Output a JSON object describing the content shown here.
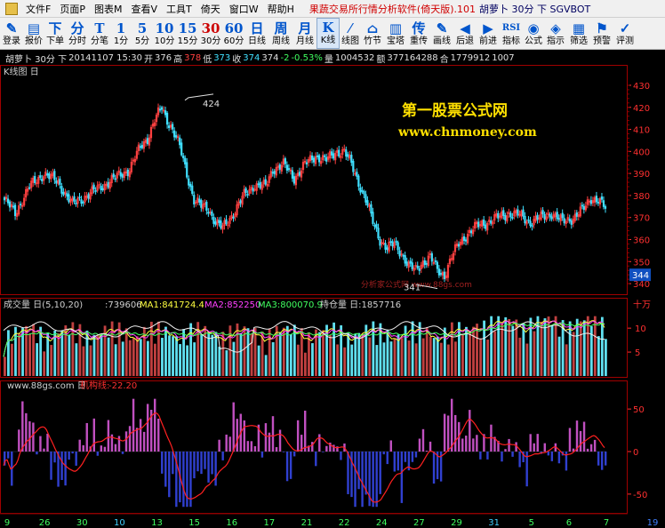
{
  "menubar": {
    "items": [
      "文件F",
      "页面P",
      "图表M",
      "查看V",
      "工具T",
      "倚天",
      "窗口W",
      "帮助H"
    ],
    "window_title": "果蔬交易所行情分析软件(倚天版).101",
    "window_symbol": "胡萝卜 30分 下 SGVBOT"
  },
  "toolbar": {
    "buttons": [
      {
        "icon": "✎",
        "label": "登录"
      },
      {
        "icon": "▤",
        "label": "报价"
      },
      {
        "icon": "下",
        "label": "下单"
      },
      {
        "icon": "分",
        "label": "分时"
      },
      {
        "icon": "T",
        "label": "分笔"
      },
      {
        "icon": "1",
        "label": "1分"
      },
      {
        "icon": "5",
        "label": "5分"
      },
      {
        "icon": "10",
        "label": "10分"
      },
      {
        "icon": "15",
        "label": "15分"
      },
      {
        "icon": "30",
        "label": "30分"
      },
      {
        "icon": "60",
        "label": "60分"
      },
      {
        "icon": "日",
        "label": "日线"
      },
      {
        "icon": "周",
        "label": "周线"
      },
      {
        "icon": "月",
        "label": "月线"
      },
      {
        "icon": "K",
        "label": "K线"
      },
      {
        "icon": "⁄",
        "label": "线图"
      },
      {
        "icon": "⌂",
        "label": "竹节"
      },
      {
        "icon": "▥",
        "label": "宝塔"
      },
      {
        "icon": "传",
        "label": "重传"
      },
      {
        "icon": "✎",
        "label": "画线"
      },
      {
        "icon": "◀",
        "label": "后退"
      },
      {
        "icon": "▶",
        "label": "前进"
      },
      {
        "icon": "RSI",
        "label": "指标"
      },
      {
        "icon": "◉",
        "label": "公式"
      },
      {
        "icon": "◈",
        "label": "指示"
      },
      {
        "icon": "▦",
        "label": "筛选"
      },
      {
        "icon": "⚑",
        "label": "预警"
      },
      {
        "icon": "✓",
        "label": "评测"
      }
    ]
  },
  "infobar": {
    "symbol": "胡萝卜 30分 下",
    "datetime": "20141107 15:30",
    "open_label": "开",
    "open": "376",
    "high_label": "高",
    "high": "378",
    "low_label": "低",
    "low": "373",
    "close_label": "收",
    "close": "374",
    "prev_close": "374",
    "change": "-2",
    "change_pct": "-0.53%",
    "volume_label": "量",
    "volume": "1004532",
    "amount_label": "额",
    "amount": "377164288",
    "oi_label": "合",
    "oi": "1779912",
    "extra": "1007"
  },
  "panels": {
    "kline": {
      "title": "K线图 日",
      "high_annotation": "424",
      "low_annotation": "341",
      "price_marker": "344",
      "watermark_title": "第一股票公式网",
      "watermark_url": "www.chnmoney.com",
      "faint_watermark": "分析家公式网 www.88gs.com"
    },
    "volume": {
      "title": "成交量 日(5,10,20)",
      "value": ":739606",
      "ma1": "MA1:841724.4",
      "ma2": "MA2:852250",
      "ma3": "MA3:800070.9",
      "oi_title": "持仓量 日:1857716",
      "unit": "十万"
    },
    "indicator": {
      "source": "www.88gs.com 日",
      "name": "机构线:",
      "value": "-22.20"
    }
  },
  "axes": {
    "price_ticks": [
      "430",
      "420",
      "410",
      "400",
      "390",
      "380",
      "370",
      "360",
      "350",
      "340"
    ],
    "volume_ticks": [
      "10",
      "5"
    ],
    "indicator_ticks": [
      "50",
      "0",
      "-50"
    ],
    "date_ticks": [
      "9",
      "26",
      "30",
      "10",
      "13",
      "15",
      "16",
      "17",
      "21",
      "22",
      "24",
      "27",
      "29",
      "31",
      "5",
      "6",
      "7",
      "19"
    ]
  },
  "chart_data": {
    "type": "candlestick",
    "price_range": [
      336,
      432
    ],
    "high_point": 424,
    "low_point": 341,
    "last_price": 344,
    "volume_range": [
      0,
      13
    ],
    "indicator_range": [
      -70,
      70
    ]
  },
  "colors": {
    "up": "#ff4040",
    "down": "#40e0ff",
    "axis_text": "#ff3030",
    "grid": "#800000",
    "watermark": "#ffe000",
    "price_marker_bg": "#1050c0"
  }
}
